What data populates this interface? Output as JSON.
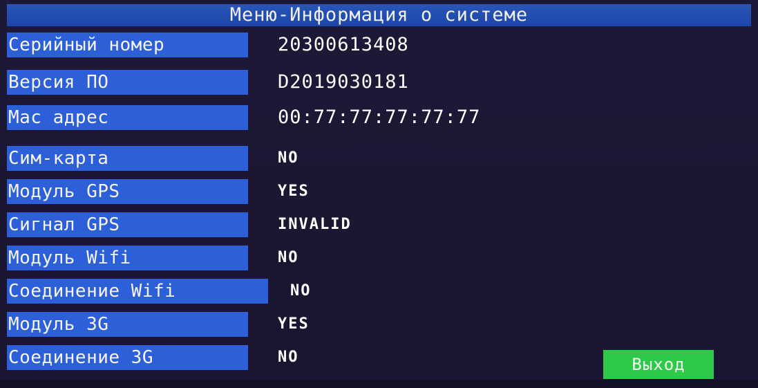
{
  "title": "Меню-Информация о системе",
  "rows": [
    {
      "label": "Серийный номер",
      "value": "20300613408"
    },
    {
      "label": "Версия ПО",
      "value": "D2019030181"
    },
    {
      "label": "Mac адрес",
      "value": "00:77:77:77:77:77"
    },
    {
      "label": "Сим-карта",
      "value": "NO"
    },
    {
      "label": "Модуль GPS",
      "value": "YES"
    },
    {
      "label": "Сигнал GPS",
      "value": "INVALID"
    },
    {
      "label": "Модуль Wifi",
      "value": "NO"
    },
    {
      "label": "Соединение Wifi",
      "value": "NO"
    },
    {
      "label": "Модуль 3G",
      "value": "YES"
    },
    {
      "label": "Соединение 3G",
      "value": "NO"
    }
  ],
  "exit_button": "Выход",
  "colors": {
    "background": "#1b1733",
    "label_bg": "#2d60d8",
    "title_bg": "#1c45a8",
    "exit_bg": "#2fc94a"
  }
}
